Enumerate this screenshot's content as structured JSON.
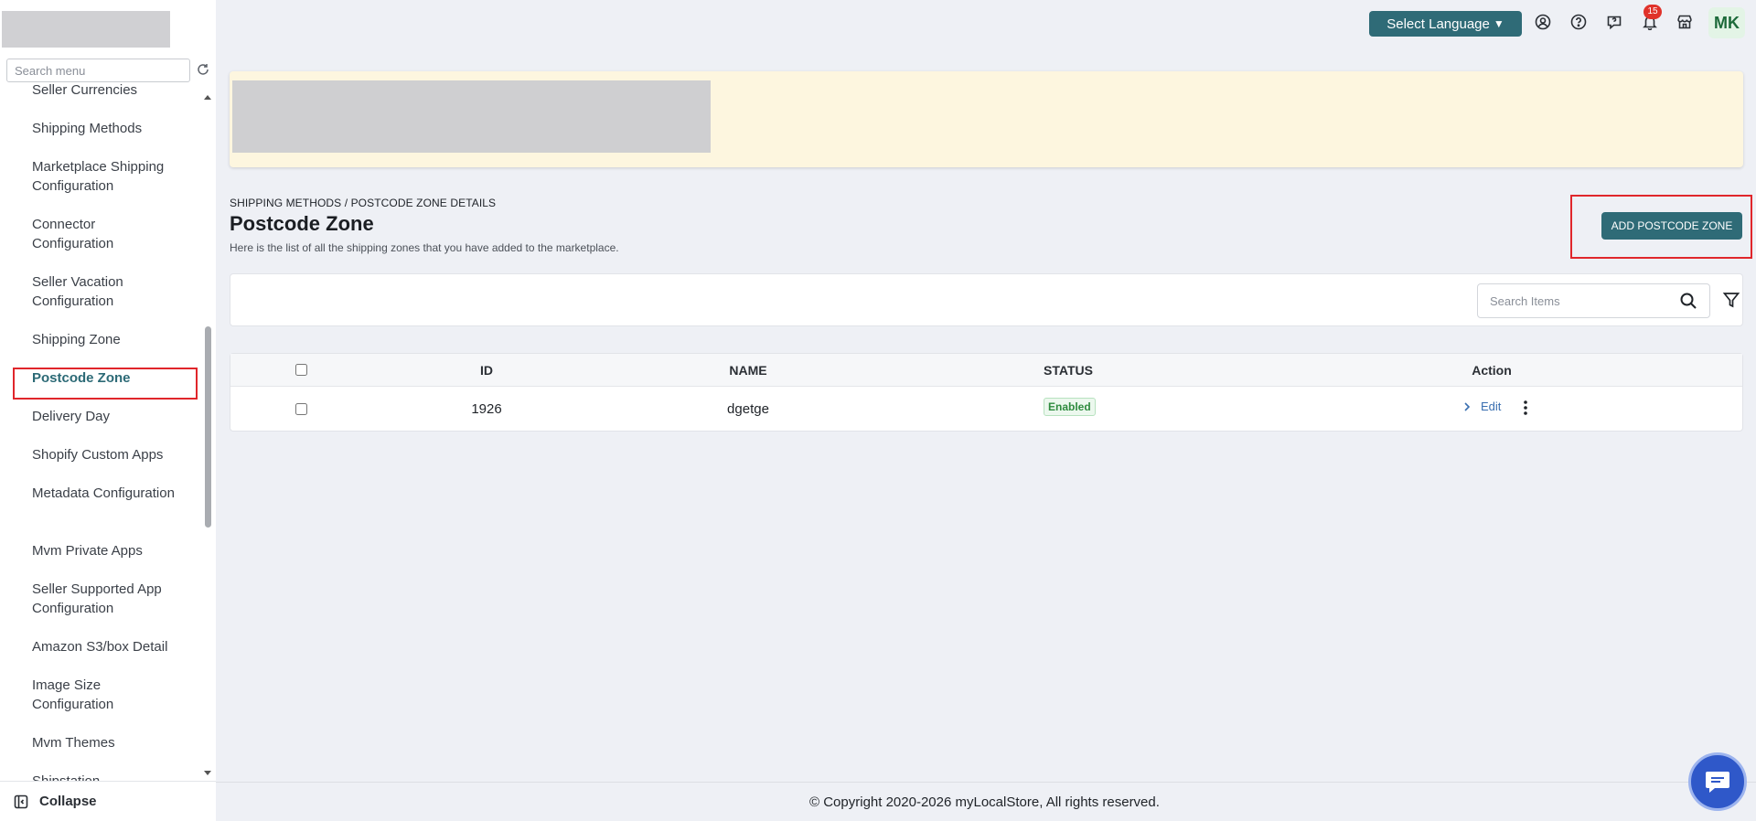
{
  "sidebar": {
    "search_placeholder": "Search menu",
    "items": [
      {
        "label": "Seller Currencies"
      },
      {
        "label": "Shipping Methods"
      },
      {
        "label": "Marketplace Shipping Configuration"
      },
      {
        "label": "Connector Configuration"
      },
      {
        "label": "Seller Vacation Configuration"
      },
      {
        "label": "Shipping Zone"
      },
      {
        "label": "Postcode Zone",
        "active": true
      },
      {
        "label": "Delivery Day"
      },
      {
        "label": "Shopify Custom Apps"
      },
      {
        "label": "Metadata Configuration"
      },
      {
        "label": "Mvm Private Apps"
      },
      {
        "label": "Seller Supported App Configuration"
      },
      {
        "label": "Amazon S3/box Detail"
      },
      {
        "label": "Image Size Configuration"
      },
      {
        "label": "Mvm Themes"
      },
      {
        "label": "Shipstation"
      }
    ],
    "collapse_label": "Collapse"
  },
  "topbar": {
    "language_label": "Select Language",
    "notification_count": "15",
    "avatar_initials": "MK",
    "icons": [
      "user-circle-icon",
      "help-icon",
      "feedback-icon",
      "bell-icon",
      "store-icon"
    ]
  },
  "header": {
    "breadcrumb": "SHIPPING METHODS / POSTCODE ZONE DETAILS",
    "title": "Postcode Zone",
    "subtitle": "Here is the list of all the shipping zones that you have added to the marketplace.",
    "add_button_label": "ADD POSTCODE ZONE"
  },
  "search": {
    "placeholder": "Search Items"
  },
  "table": {
    "columns": [
      "ID",
      "NAME",
      "STATUS",
      "Action"
    ],
    "rows": [
      {
        "id": "1926",
        "name": "dgetge",
        "status": "Enabled",
        "action": "Edit"
      }
    ]
  },
  "footer": {
    "copyright": "© Copyright 2020-2026 myLocalStore, All rights reserved."
  },
  "colors": {
    "accent": "#2f6b77",
    "highlight_box": "#e0262b",
    "banner_bg": "#fdf6df",
    "status_enabled": "#2e8b3e",
    "chat_button": "#2f58c9"
  }
}
